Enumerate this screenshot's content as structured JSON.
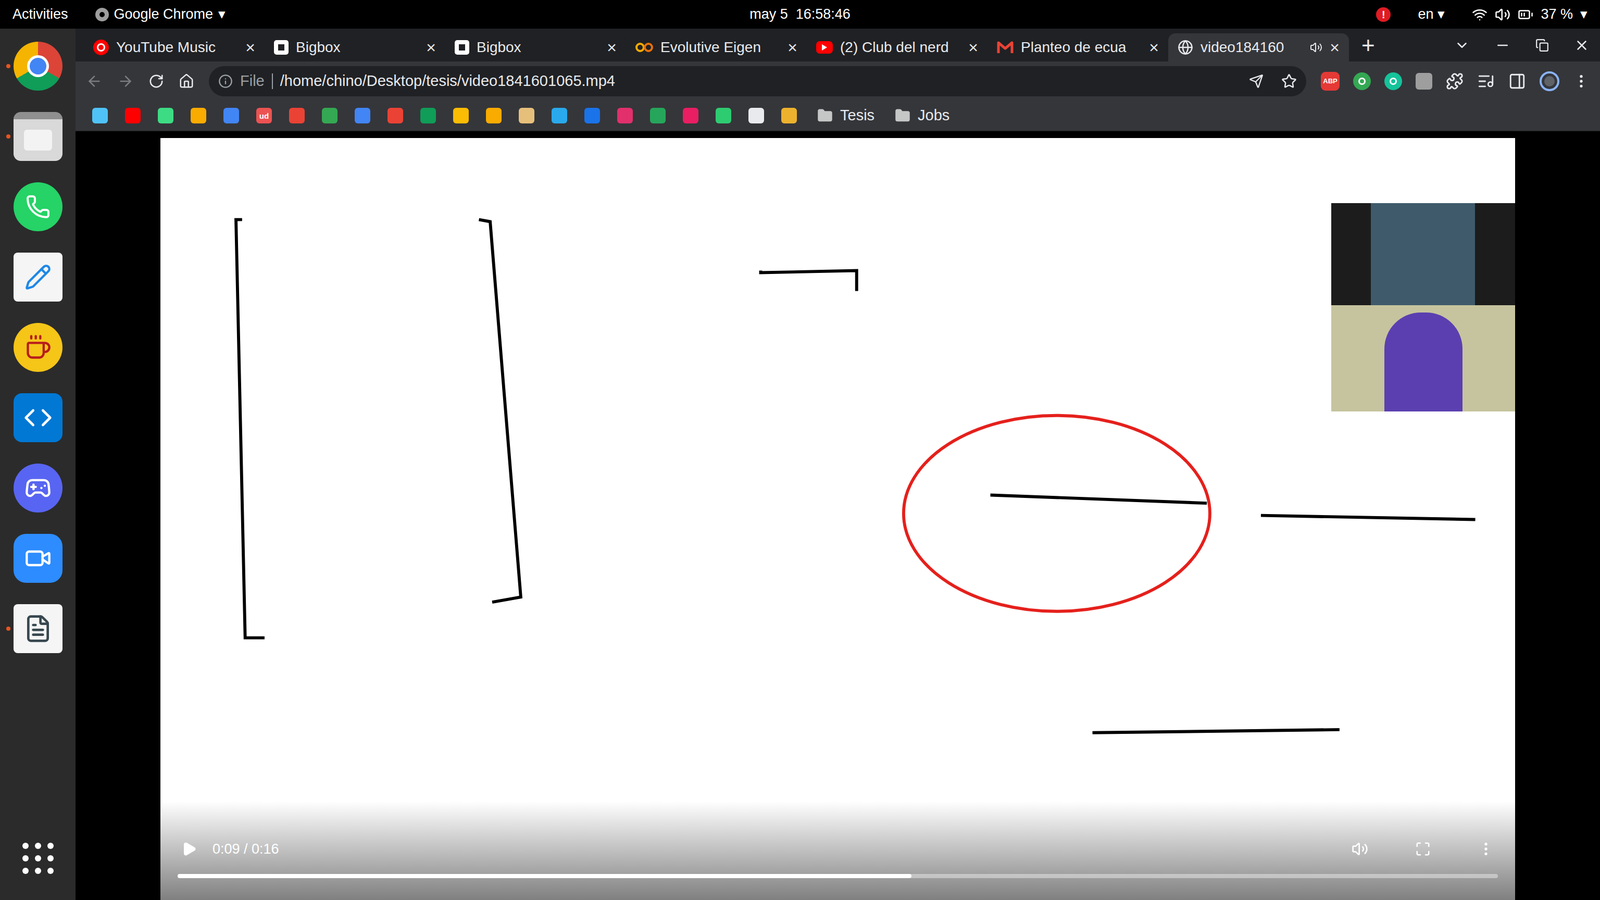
{
  "top_bar": {
    "activities": "Activities",
    "app_menu": "Google Chrome",
    "app_menu_arrow": "▾",
    "clock": "may 5  16:58:46",
    "alert": "!",
    "input_source": "en",
    "input_arrow": "▾",
    "battery": "37 %",
    "system_arrow": "▾"
  },
  "dock": {
    "items": [
      {
        "kind": "chrome",
        "running": true
      },
      {
        "kind": "files",
        "running": true
      },
      {
        "kind": "whatsapp",
        "running": false
      },
      {
        "kind": "text-editor",
        "running": false
      },
      {
        "kind": "teapot",
        "running": false
      },
      {
        "kind": "vscode",
        "running": false
      },
      {
        "kind": "discord",
        "running": false
      },
      {
        "kind": "zoom",
        "running": false
      },
      {
        "kind": "document-viewer",
        "running": true
      }
    ]
  },
  "browser": {
    "tabs": [
      {
        "label": "YouTube Music",
        "kind": "youtube-music",
        "selected": false,
        "audio": false
      },
      {
        "label": "Bigbox",
        "kind": "bigbox",
        "selected": false,
        "audio": false
      },
      {
        "label": "Bigbox",
        "kind": "bigbox",
        "selected": false,
        "audio": false
      },
      {
        "label": "Evolutive Eigen",
        "kind": "colab",
        "selected": false,
        "audio": false
      },
      {
        "label": "(2) Club del nerd",
        "kind": "youtube",
        "selected": false,
        "audio": false
      },
      {
        "label": "Planteo de ecua",
        "kind": "gmail",
        "selected": false,
        "audio": false
      },
      {
        "label": "video184160",
        "kind": "globe",
        "selected": true,
        "audio": true
      }
    ],
    "tab_close": "×",
    "new_tab": "+",
    "address": {
      "scheme": "File",
      "path": "/home/chino/Desktop/tesis/video1841601065.mp4"
    },
    "extensions": [
      {
        "kind": "abp",
        "label": "ABP",
        "color": "#e53935"
      },
      {
        "kind": "circle",
        "label": "",
        "color": "#34a853"
      },
      {
        "kind": "circle",
        "label": "",
        "color": "#15c39a"
      },
      {
        "kind": "square",
        "label": "",
        "color": "#9e9e9e"
      },
      {
        "kind": "puzzle",
        "label": "",
        "color": "#e8eaed"
      },
      {
        "kind": "media",
        "label": "",
        "color": "#e8eaed"
      },
      {
        "kind": "sidebar",
        "label": "",
        "color": "#e8eaed"
      },
      {
        "kind": "profile",
        "label": "",
        "color": "#8ab4f8"
      }
    ],
    "bookmarks": [
      {
        "color": "#4fc3f7",
        "label": ""
      },
      {
        "color": "#ff0000",
        "label": ""
      },
      {
        "color": "#3ddc84",
        "label": ""
      },
      {
        "color": "#f9ab00",
        "label": ""
      },
      {
        "color": "#4285f4",
        "label": ""
      },
      {
        "color": "#ec5252",
        "label": "ud"
      },
      {
        "color": "#ea4335",
        "label": ""
      },
      {
        "color": "#34a853",
        "label": ""
      },
      {
        "color": "#4285f4",
        "label": ""
      },
      {
        "color": "#ea4335",
        "label": ""
      },
      {
        "color": "#0f9d58",
        "label": ""
      },
      {
        "color": "#fbbc04",
        "label": ""
      },
      {
        "color": "#f9ab00",
        "label": ""
      },
      {
        "color": "#e6c07b",
        "label": ""
      },
      {
        "color": "#29a9eb",
        "label": ""
      },
      {
        "color": "#1a73e8",
        "label": ""
      },
      {
        "color": "#e1306c",
        "label": ""
      },
      {
        "color": "#26a65b",
        "label": ""
      },
      {
        "color": "#e91e63",
        "label": ""
      },
      {
        "color": "#2ecc71",
        "label": ""
      },
      {
        "color": "#e8eaed",
        "label": ""
      },
      {
        "color": "#ecb22e",
        "label": ""
      }
    ],
    "folders": [
      "Tesis",
      "Jobs"
    ]
  },
  "video": {
    "playing": false,
    "time": "0:09 / 0:16",
    "level": 0.556,
    "muted": false
  }
}
